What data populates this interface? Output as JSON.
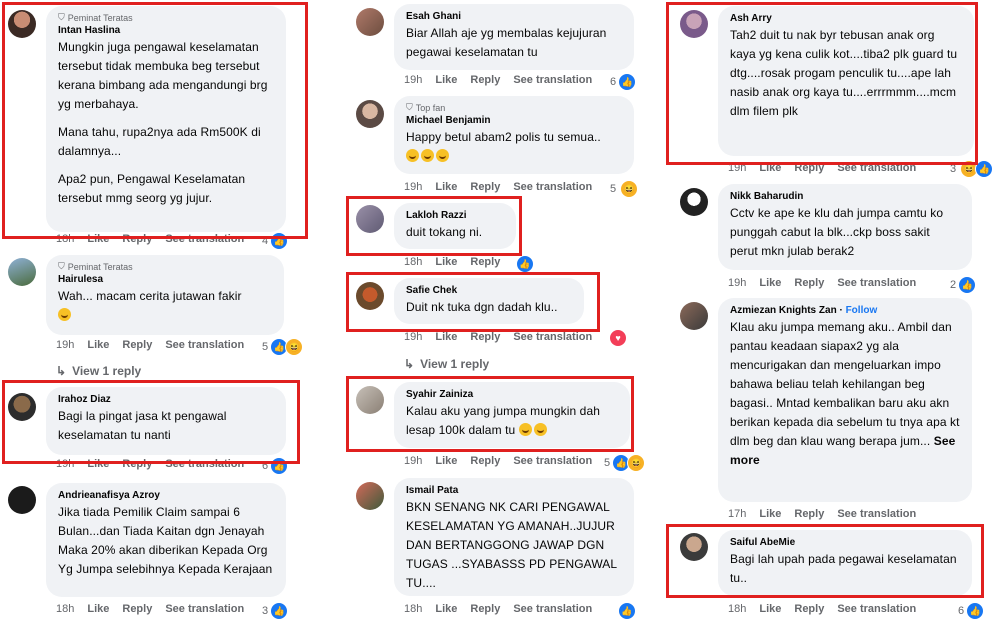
{
  "labels": {
    "like": "Like",
    "reply": "Reply",
    "see_translation": "See translation"
  },
  "col1": {
    "c1": {
      "fan": "Peminat Teratas",
      "author": "Intan Haslina",
      "p1": "Mungkin juga pengawal keselamatan tersebut tidak membuka beg tersebut kerana bimbang ada mengandungi brg yg merbahaya.",
      "p2": "Mana tahu, rupa2nya ada Rm500K di dalamnya...",
      "p3": "Apa2 pun, Pengawal Keselamatan tersebut mmg seorg yg jujur.",
      "time": "18h",
      "count": "4"
    },
    "c2": {
      "fan": "Peminat Teratas",
      "author": "Hairulesa",
      "text": "Wah... macam cerita jutawan fakir",
      "time": "19h",
      "count": "5",
      "view_reply": "View 1 reply"
    },
    "c3": {
      "author": "Irahoz Diaz",
      "text": "Bagi la pingat jasa kt pengawal keselamatan tu nanti",
      "time": "19h",
      "count": "6"
    },
    "c4": {
      "author": "Andrieanafisya Azroy",
      "text": "Jika tiada Pemilik Claim sampai 6 Bulan...dan Tiada Kaitan dgn Jenayah Maka 20% akan diberikan Kepada Org Yg Jumpa selebihnya Kepada Kerajaan",
      "time": "18h",
      "count": "3"
    }
  },
  "col2": {
    "c1": {
      "author": "Esah Ghani",
      "text": "Biar Allah aje yg membalas kejujuran pegawai keselamatan tu",
      "time": "19h",
      "count": "6"
    },
    "c2": {
      "fan": "Top fan",
      "author": "Michael Benjamin",
      "text": "Happy betul abam2 polis tu semua..",
      "time": "19h",
      "count": "5"
    },
    "c3": {
      "author": "Lakloh Razzi",
      "text": "duit tokang ni.",
      "time": "18h"
    },
    "c4": {
      "author": "Safie Chek",
      "text": "Duit nk tuka dgn dadah klu..",
      "time": "19h",
      "view_reply": "View 1 reply"
    },
    "c5": {
      "author": "Syahir Zainiza",
      "text": "Kalau aku yang jumpa mungkin dah lesap 100k dalam tu",
      "time": "19h",
      "count": "5"
    },
    "c6": {
      "author": "Ismail Pata",
      "text": "BKN SENANG NK CARI PENGAWAL KESELAMATAN YG AMANAH..JUJUR DAN BERTANGGONG JAWAP DGN TUGAS ...SYABASSS PD PENGAWAL TU....",
      "time": "18h"
    }
  },
  "col3": {
    "c1": {
      "author": "Ash Arry",
      "text": "Tah2 duit tu nak byr tebusan anak org kaya yg kena culik kot....tiba2 plk guard tu dtg....rosak progam penculik tu....ape lah nasib anak org kaya tu....errrmmm....mcm dlm filem plk",
      "time": "19h",
      "count": "3"
    },
    "c2": {
      "author": "Nikk Baharudin",
      "text": "Cctv ke ape ke klu dah jumpa camtu ko punggah cabut la blk...ckp boss sakit perut mkn julab berak2",
      "time": "19h",
      "count": "2"
    },
    "c3": {
      "author": "Azmiezan Knights Zan",
      "follow": "Follow",
      "text": "Klau aku jumpa memang aku.. Ambil dan pantau keadaan siapax2 yg ala mencurigakan dan mengeluarkan impo bahawa beliau telah kehilangan beg bagasi.. Mntad kembalikan baru aku akn berikan kepada dia sebelum tu tnya apa kt dlm beg dan klau wang berapa jum...",
      "see_more": "See more",
      "time": "17h"
    },
    "c4": {
      "author": "Saiful AbeMie",
      "text": "Bagi lah upah pada pegawai keselamatan tu..",
      "time": "18h",
      "count": "6"
    }
  },
  "colors": {
    "highlight": "#e0201f",
    "like_blue": "#1877f2",
    "bubble": "#f0f2f5",
    "meta": "#65676b"
  }
}
